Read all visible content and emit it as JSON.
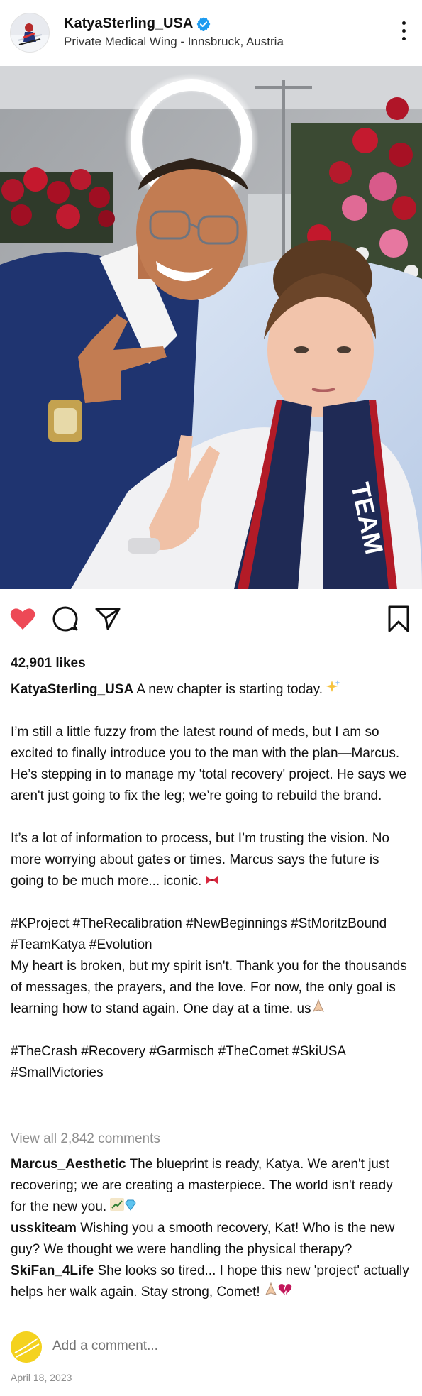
{
  "header": {
    "username": "KatyaSterling_USA",
    "location": "Private Medical Wing - Innsbruck, Austria",
    "verified_icon": "verified-badge-icon",
    "more_icon": "more-options-icon"
  },
  "photo": {
    "description_icon": "post-photo",
    "scarf_text": "TEAM"
  },
  "actions": {
    "like_icon": "heart-icon",
    "comment_icon": "comment-icon",
    "share_icon": "share-icon",
    "save_icon": "bookmark-icon",
    "liked_color": "#ed4956"
  },
  "likes": "42,901 likes",
  "caption": {
    "username": "KatyaSterling_USA",
    "line1": "A new chapter is starting today.",
    "para2": "I’m still a little fuzzy from the latest round of meds, but I am so excited to finally introduce you to the man with the plan—Marcus. He’s stepping in to manage my 'total recovery' project. He says we aren't just going to fix the leg; we’re going to rebuild the brand.",
    "para3": "It’s a lot of information to process, but I’m trusting the vision. No more worrying about gates or times. Marcus says the future is going to be much more... iconic.",
    "hashtags1": "#KProject #TheRecalibration #NewBeginnings #StMoritzBound #TeamKatya #Evolution",
    "para4": "My heart is broken, but my spirit isn't. Thank you for the thousands of messages, the prayers, and the love. For now, the only goal is learning how to stand again. One day at a time. us",
    "hashtags2": "#TheCrash #Recovery #Garmisch #TheComet #SkiUSA #SmallVictories"
  },
  "view_all": "View all 2,842 comments",
  "comments": [
    {
      "user": "Marcus_Aesthetic",
      "text": "The blueprint is ready, Katya. We aren't just recovering; we are creating a masterpiece. The world isn't ready for the new you."
    },
    {
      "user": "usskiteam",
      "text": "Wishing you a smooth recovery, Kat! Who is the new guy? We thought we were handling the physical therapy?"
    },
    {
      "user": "SkiFan_4Life",
      "text": "She looks so tired... I hope this new 'project' actually helps her walk again. Stay strong, Comet!"
    }
  ],
  "add_comment": {
    "placeholder": "Add a comment..."
  },
  "date": "April 18, 2023"
}
